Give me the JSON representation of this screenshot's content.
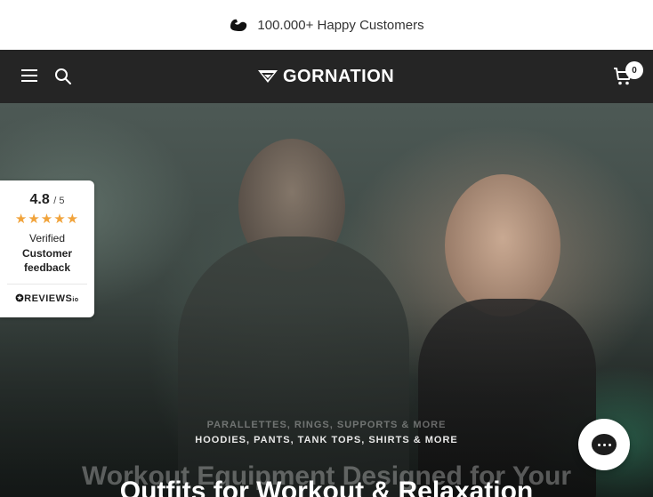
{
  "announcement": {
    "text": "100.000+ Happy Customers",
    "icon": "flexed-arm-icon"
  },
  "header": {
    "logo_text": "GORNATION",
    "cart_count": "0",
    "icons": [
      "menu-icon",
      "search-icon",
      "cart-icon"
    ]
  },
  "hero": {
    "subtitle_faded": "PARALLETTES, RINGS, SUPPORTS & MORE",
    "subtitle": "HOODIES, PANTS, TANK TOPS, SHIRTS & MORE",
    "heading_faded": "Workout Equipment Designed for Your",
    "heading": "Outfits for Workout & Relaxation"
  },
  "reviews_widget": {
    "score": "4.8",
    "out_of": "/ 5",
    "stars": "★★★★★",
    "verified": "Verified",
    "feedback": "Customer feedback",
    "brand": "REVIEWS",
    "brand_suffix": "io"
  },
  "colors": {
    "header_bg": "#252525",
    "star": "#f1a33b",
    "announcement_bg": "#ffffff"
  }
}
